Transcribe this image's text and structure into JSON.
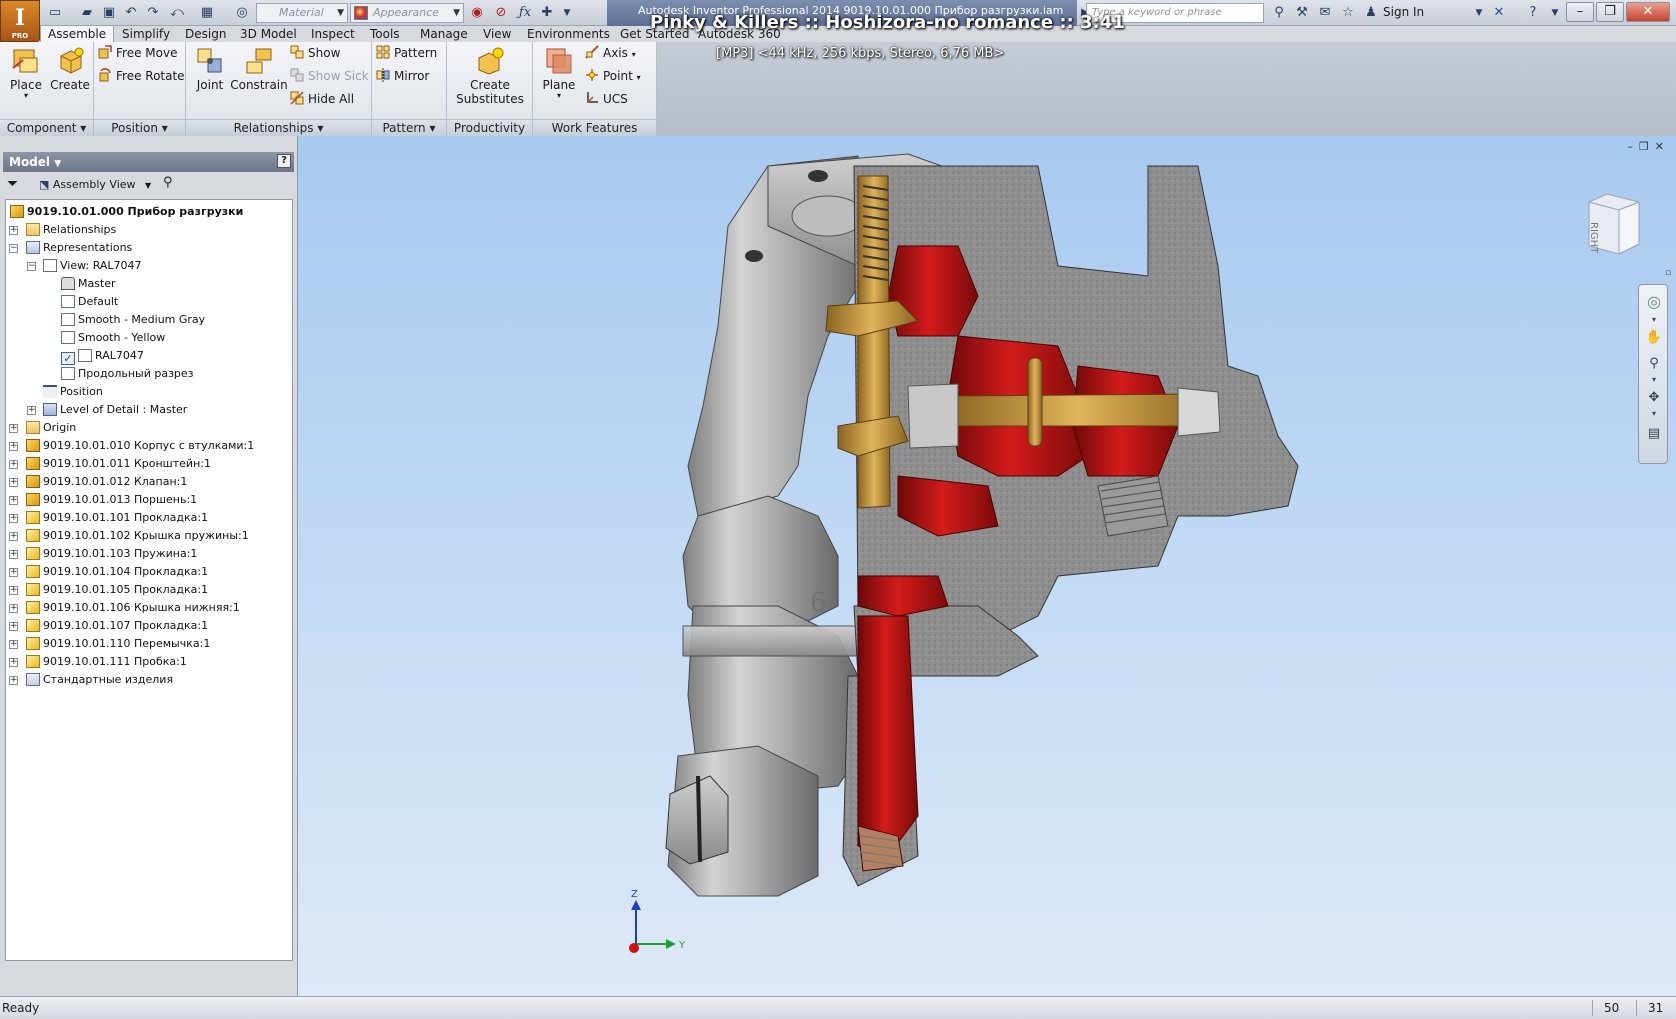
{
  "app": {
    "logo_letter": "I",
    "logo_sub": "PRO",
    "title": "Autodesk Inventor Professional 2014     9019.10.01.000 Прибор разгрузки.iam",
    "media_title": "Pinky & Killers :: Hoshizora-no romance :: 3:41",
    "media_info": "[MP3]  <44 kHz, 256 kbps, Stereo, 6,76 MB>"
  },
  "quick_access": {
    "material_placeholder": "Material",
    "appearance_placeholder": "Appearance",
    "search_placeholder": "Type a keyword or phrase",
    "sign_in": "Sign In"
  },
  "tabs": [
    "Assemble",
    "Simplify",
    "Design",
    "3D Model",
    "Inspect",
    "Tools",
    "Manage",
    "View",
    "Environments",
    "Get Started",
    "Autodesk 360"
  ],
  "ribbon": {
    "component": {
      "label": "Component",
      "place": "Place",
      "create": "Create"
    },
    "position": {
      "label": "Position",
      "free_move": "Free Move",
      "free_rotate": "Free Rotate"
    },
    "relationships": {
      "label": "Relationships",
      "joint": "Joint",
      "constrain": "Constrain",
      "show": "Show",
      "show_sick": "Show Sick",
      "hide_all": "Hide All"
    },
    "pattern": {
      "label": "Pattern",
      "pattern": "Pattern",
      "mirror": "Mirror"
    },
    "productivity": {
      "label": "Productivity",
      "create_substitutes_1": "Create",
      "create_substitutes_2": "Substitutes"
    },
    "work_features": {
      "label": "Work Features",
      "plane": "Plane",
      "axis": "Axis",
      "point": "Point",
      "ucs": "UCS"
    }
  },
  "browser": {
    "title": "Model",
    "help": "?",
    "view_selector": "Assembly View",
    "tree": [
      {
        "label": "9019.10.01.000 Прибор разгрузки",
        "icon": "assembly-icon"
      },
      {
        "label": "Relationships",
        "icon": "folder-icon"
      },
      {
        "label": "Representations",
        "icon": "representations-icon"
      },
      {
        "label": "View: RAL7047",
        "icon": "view-rep-icon"
      },
      {
        "label": "Master",
        "icon": "lock-icon"
      },
      {
        "label": "Default",
        "icon": "view-rep-icon"
      },
      {
        "label": "Smooth - Medium Gray",
        "icon": "view-rep-icon"
      },
      {
        "label": "Smooth - Yellow",
        "icon": "view-rep-icon"
      },
      {
        "label": "RAL7047",
        "icon": "check-icon"
      },
      {
        "label": "Продольный разрез",
        "icon": "view-rep-icon"
      },
      {
        "label": "Position",
        "icon": "position-icon"
      },
      {
        "label": "Level of Detail : Master",
        "icon": "lod-icon"
      },
      {
        "label": "Origin",
        "icon": "folder-icon"
      },
      {
        "label": "9019.10.01.010 Корпус с втулками:1",
        "icon": "assembly-icon"
      },
      {
        "label": "9019.10.01.011 Кронштейн:1",
        "icon": "assembly-icon"
      },
      {
        "label": "9019.10.01.012 Клапан:1",
        "icon": "assembly-icon"
      },
      {
        "label": "9019.10.01.013 Поршень:1",
        "icon": "assembly-icon"
      },
      {
        "label": "9019.10.01.101 Прокладка:1",
        "icon": "part-icon"
      },
      {
        "label": "9019.10.01.102 Крышка пружины:1",
        "icon": "part-icon"
      },
      {
        "label": "9019.10.01.103 Пружина:1",
        "icon": "part-icon"
      },
      {
        "label": "9019.10.01.104 Прокладка:1",
        "icon": "part-icon"
      },
      {
        "label": "9019.10.01.105 Прокладка:1",
        "icon": "part-icon"
      },
      {
        "label": "9019.10.01.106 Крышка нижняя:1",
        "icon": "part-icon"
      },
      {
        "label": "9019.10.01.107 Прокладка:1",
        "icon": "part-icon"
      },
      {
        "label": "9019.10.01.110 Перемычка:1",
        "icon": "part-icon"
      },
      {
        "label": "9019.10.01.111 Пробка:1",
        "icon": "part-icon"
      },
      {
        "label": "Стандартные изделия",
        "icon": "standard-parts-icon"
      }
    ]
  },
  "viewport": {
    "viewcube_face": "RIGHT",
    "part_marking": "6",
    "triad_z": "Z",
    "triad_y": "Y"
  },
  "status": {
    "text": "Ready",
    "num1": "50",
    "num2": "31"
  },
  "colors": {
    "section_red": "#b81414",
    "brass": "#c89a3a",
    "casting_gray": "#9c9c9c",
    "viewport_top": "#a8c9ef"
  }
}
